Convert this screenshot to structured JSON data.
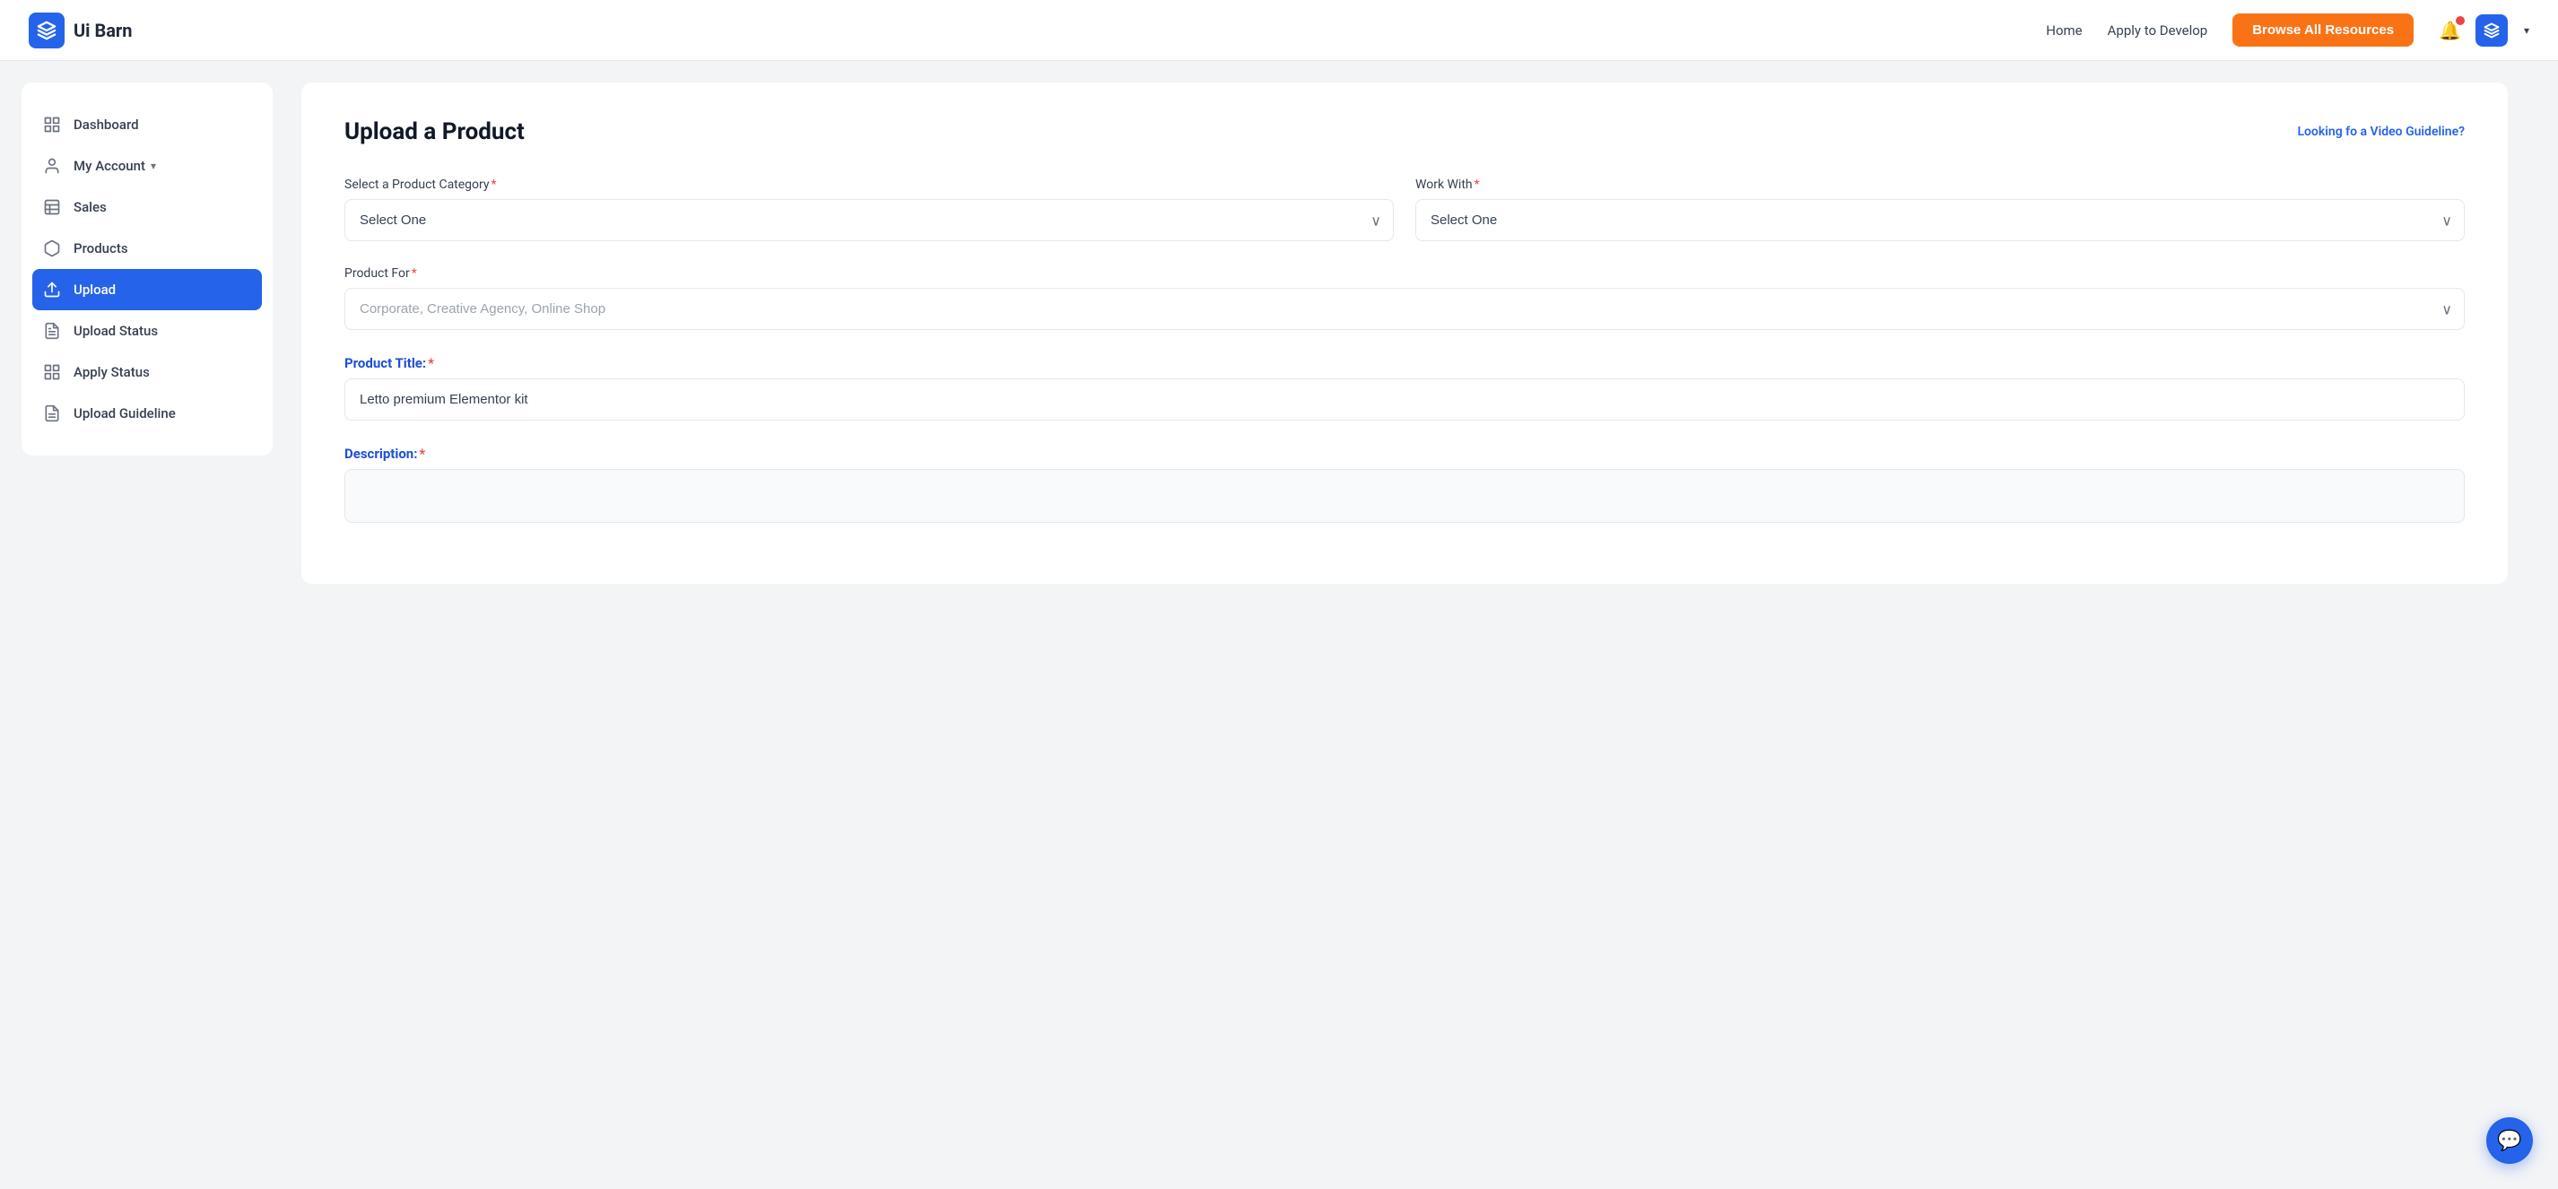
{
  "header": {
    "logo_text": "Ui Barn",
    "nav": {
      "home": "Home",
      "apply_to_develop": "Apply to Develop",
      "browse_all": "Browse All Resources"
    }
  },
  "sidebar": {
    "items": [
      {
        "id": "dashboard",
        "label": "Dashboard",
        "icon": "grid"
      },
      {
        "id": "my-account",
        "label": "My Account",
        "icon": "user",
        "has_chevron": true
      },
      {
        "id": "sales",
        "label": "Sales",
        "icon": "list"
      },
      {
        "id": "products",
        "label": "Products",
        "icon": "box"
      },
      {
        "id": "upload",
        "label": "Upload",
        "icon": "upload",
        "active": true
      },
      {
        "id": "upload-status",
        "label": "Upload Status",
        "icon": "file-text"
      },
      {
        "id": "apply-status",
        "label": "Apply Status",
        "icon": "grid-sm"
      },
      {
        "id": "upload-guideline",
        "label": "Upload Guideline",
        "icon": "file-list"
      }
    ]
  },
  "main": {
    "form_title": "Upload a Product",
    "video_guideline_link": "Looking fo a Video Guideline?",
    "fields": {
      "product_category_label": "Select a Product Category",
      "product_category_placeholder": "Select One",
      "work_with_label": "Work With",
      "work_with_placeholder": "Select One",
      "product_for_label": "Product For",
      "product_for_placeholder": "Corporate, Creative Agency, Online Shop",
      "product_title_label": "Product Title:",
      "product_title_value": "Letto premium Elementor kit",
      "description_label": "Description:"
    }
  }
}
